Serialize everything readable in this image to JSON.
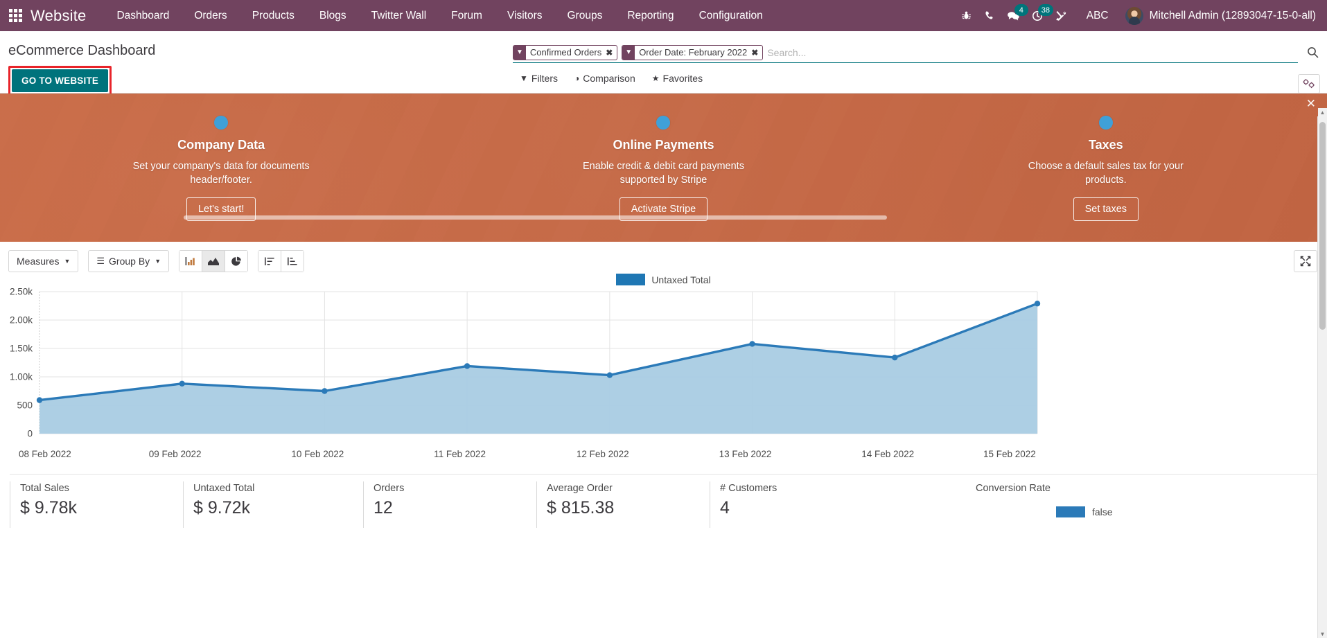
{
  "navbar": {
    "apps_icon": "apps-grid-icon",
    "brand": "Website",
    "menu": [
      {
        "label": "Dashboard"
      },
      {
        "label": "Orders"
      },
      {
        "label": "Products"
      },
      {
        "label": "Blogs"
      },
      {
        "label": "Twitter Wall"
      },
      {
        "label": "Forum"
      },
      {
        "label": "Visitors"
      },
      {
        "label": "Groups"
      },
      {
        "label": "Reporting"
      },
      {
        "label": "Configuration"
      }
    ],
    "sys_icons": [
      {
        "name": "bug-icon",
        "badge": ""
      },
      {
        "name": "phone-icon",
        "badge": ""
      },
      {
        "name": "messages-icon",
        "badge": "4"
      },
      {
        "name": "activities-clock-icon",
        "badge": "38"
      },
      {
        "name": "tools-icon",
        "badge": ""
      }
    ],
    "abc_label": "ABC",
    "user_name": "Mitchell Admin (12893047-15-0-all)"
  },
  "control_panel": {
    "page_title": "eCommerce Dashboard",
    "go_to_website_label": "GO TO WEBSITE",
    "facets": [
      {
        "label": "Confirmed Orders",
        "remove": "✖"
      },
      {
        "label": "Order Date: February 2022",
        "remove": "✖"
      }
    ],
    "search_placeholder": "Search...",
    "search_value": "",
    "dropdowns": [
      {
        "label": "Filters",
        "icon": "filter-icon"
      },
      {
        "label": "Comparison",
        "icon": "comparison-icon"
      },
      {
        "label": "Favorites",
        "icon": "star-icon"
      }
    ],
    "settings_icon": "panel-settings-icon"
  },
  "banner": {
    "close_label": "✕",
    "steps": [
      {
        "title": "Company Data",
        "desc": "Set your company's data for documents header/footer.",
        "button": "Let's start!"
      },
      {
        "title": "Online Payments",
        "desc": "Enable credit & debit card payments supported by Stripe",
        "button": "Activate Stripe"
      },
      {
        "title": "Taxes",
        "desc": "Choose a default sales tax for your products.",
        "button": "Set taxes"
      }
    ]
  },
  "graph_toolbar": {
    "measures_label": "Measures",
    "group_by_label": "Group By",
    "chart_types": [
      {
        "name": "bar-chart-icon",
        "active": false
      },
      {
        "name": "line-chart-icon",
        "active": true
      },
      {
        "name": "pie-chart-icon",
        "active": false
      }
    ],
    "sort_buttons": [
      {
        "name": "sort-descending-icon"
      },
      {
        "name": "sort-ascending-icon"
      }
    ],
    "expand_icon": "expand-fullscreen-icon"
  },
  "chart_data": {
    "type": "area",
    "title": "",
    "xlabel": "",
    "ylabel": "",
    "legend_position": "top-center",
    "grid": true,
    "ylim": [
      0,
      2500
    ],
    "yticks": [
      0,
      500,
      1000,
      1500,
      2000,
      2500
    ],
    "ytick_labels": [
      "0",
      "500",
      "1.00k",
      "1.50k",
      "2.00k",
      "2.50k"
    ],
    "categories": [
      "08 Feb 2022",
      "09 Feb 2022",
      "10 Feb 2022",
      "11 Feb 2022",
      "12 Feb 2022",
      "13 Feb 2022",
      "14 Feb 2022",
      "15 Feb 2022"
    ],
    "series": [
      {
        "name": "Untaxed Total",
        "color": "#2b7ab8",
        "fill": "#a9cce3",
        "values": [
          590,
          880,
          750,
          1190,
          1030,
          1580,
          1340,
          2290
        ]
      }
    ]
  },
  "kpis": [
    {
      "label": "Total Sales",
      "value": "$ 9.78k"
    },
    {
      "label": "Untaxed Total",
      "value": "$ 9.72k"
    },
    {
      "label": "Orders",
      "value": "12"
    },
    {
      "label": "Average Order",
      "value": "$ 815.38"
    },
    {
      "label": "# Customers",
      "value": "4"
    }
  ],
  "conversion": {
    "label": "Conversion Rate",
    "legend_label": "false"
  }
}
